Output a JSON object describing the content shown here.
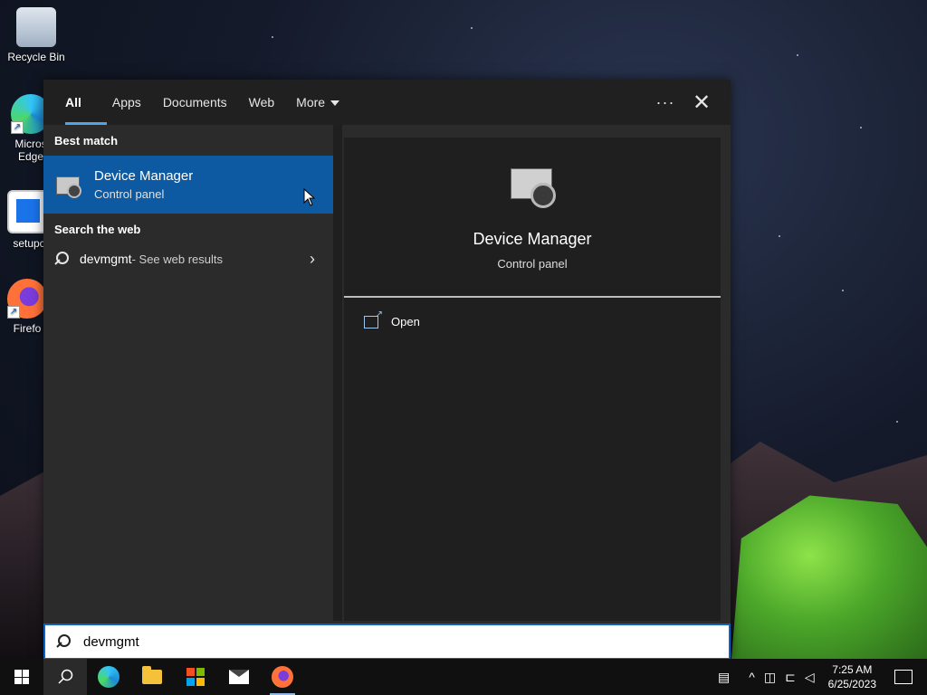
{
  "desktop": {
    "icons": [
      {
        "label": "Recycle Bin",
        "icon": "recycle-bin-icon"
      },
      {
        "label": "Micros\nEdge",
        "icon": "edge-icon"
      },
      {
        "label": "setupc",
        "icon": "setup-icon"
      },
      {
        "label": "Firefo",
        "icon": "firefox-icon"
      }
    ]
  },
  "search_panel": {
    "tabs": [
      {
        "label": "All",
        "active": true
      },
      {
        "label": "Apps"
      },
      {
        "label": "Documents"
      },
      {
        "label": "Web"
      },
      {
        "label": "More"
      }
    ],
    "ellipsis": "···",
    "close": "✕",
    "best_match_header": "Best match",
    "best_match": {
      "title": "Device Manager",
      "subtitle": "Control panel",
      "icon": "device-manager-icon"
    },
    "web_header": "Search the web",
    "web_result": {
      "query": "devmgmt",
      "suffix": " - See web results"
    },
    "preview": {
      "title": "Device Manager",
      "subtitle": "Control panel",
      "action": "Open"
    },
    "search_value": "devmgmt"
  },
  "taskbar": {
    "apps": [
      "start-icon",
      "search-icon",
      "edge-icon",
      "file-explorer-icon",
      "store-icon",
      "mail-icon",
      "firefox-icon"
    ],
    "time": "7:25 AM",
    "date": "6/25/2023"
  },
  "colors": {
    "accent": "#0e5aa2",
    "search_border": "#0b63c5",
    "panel_bg": "#2b2b2b"
  }
}
